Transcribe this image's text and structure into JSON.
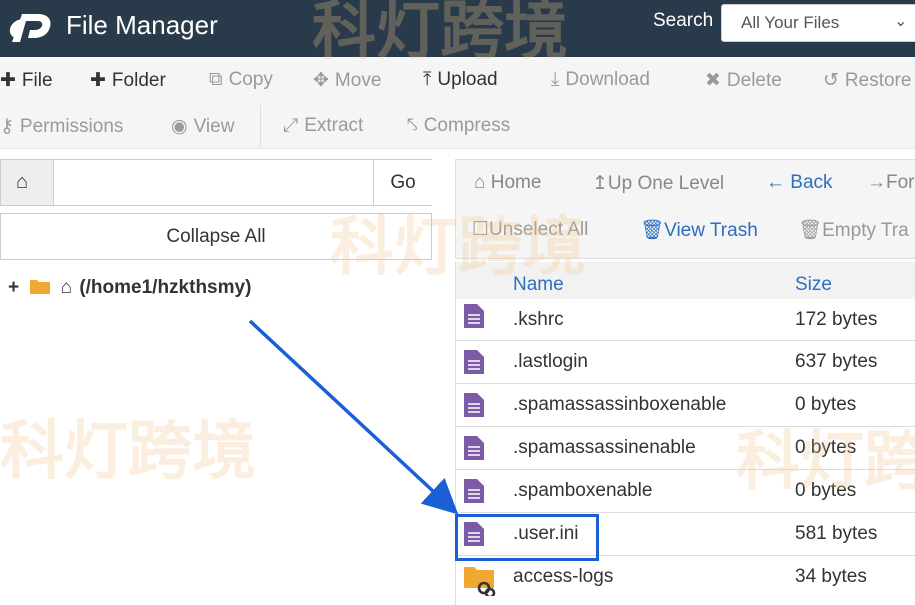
{
  "header": {
    "app_title": "File Manager",
    "search_label": "Search",
    "search_scope": "All Your Files"
  },
  "toolbar_row1": [
    {
      "label": "File",
      "icon": "plus-icon",
      "enabled": true
    },
    {
      "label": "Folder",
      "icon": "plus-icon",
      "enabled": true
    },
    {
      "label": "Copy",
      "icon": "copy-icon",
      "enabled": false
    },
    {
      "label": "Move",
      "icon": "move-icon",
      "enabled": false
    },
    {
      "label": "Upload",
      "icon": "upload-icon",
      "enabled": true
    },
    {
      "label": "Download",
      "icon": "download-icon",
      "enabled": false
    },
    {
      "label": "Delete",
      "icon": "delete-icon",
      "enabled": false
    },
    {
      "label": "Restore",
      "icon": "restore-icon",
      "enabled": false
    }
  ],
  "toolbar_row2": [
    {
      "label": "Permissions",
      "icon": "key-icon",
      "enabled": false
    },
    {
      "label": "View",
      "icon": "eye-icon",
      "enabled": false
    },
    {
      "label": "Extract",
      "icon": "expand-icon",
      "enabled": false
    },
    {
      "label": "Compress",
      "icon": "compress-icon",
      "enabled": false
    }
  ],
  "path_bar": {
    "value": "",
    "go_label": "Go"
  },
  "tree": {
    "collapse_all_label": "Collapse All",
    "root_label": "(/home1/hzkthsmy)"
  },
  "nav": {
    "home": "Home",
    "up_one_level": "Up One Level",
    "back": "Back",
    "forward": "For",
    "unselect_all": "Unselect All",
    "view_trash": "View Trash",
    "empty_trash": "Empty Tra"
  },
  "file_table": {
    "columns": [
      "Name",
      "Size"
    ],
    "rows": [
      {
        "name": ".kshrc",
        "size": "172 bytes",
        "type": "file"
      },
      {
        "name": ".lastlogin",
        "size": "637 bytes",
        "type": "file"
      },
      {
        "name": ".spamassassinboxenable",
        "size": "0 bytes",
        "type": "file"
      },
      {
        "name": ".spamassassinenable",
        "size": "0 bytes",
        "type": "file"
      },
      {
        "name": ".spamboxenable",
        "size": "0 bytes",
        "type": "file"
      },
      {
        "name": ".user.ini",
        "size": "581 bytes",
        "type": "file"
      },
      {
        "name": "access-logs",
        "size": "34 bytes",
        "type": "folder-link"
      }
    ]
  },
  "watermark_text": "科灯跨境",
  "colors": {
    "header_bg": "#293a4a",
    "link_blue": "#2c6ebf",
    "file_icon": "#7b5aa6",
    "folder": "#f0a830",
    "highlight": "#1a5fd6"
  }
}
